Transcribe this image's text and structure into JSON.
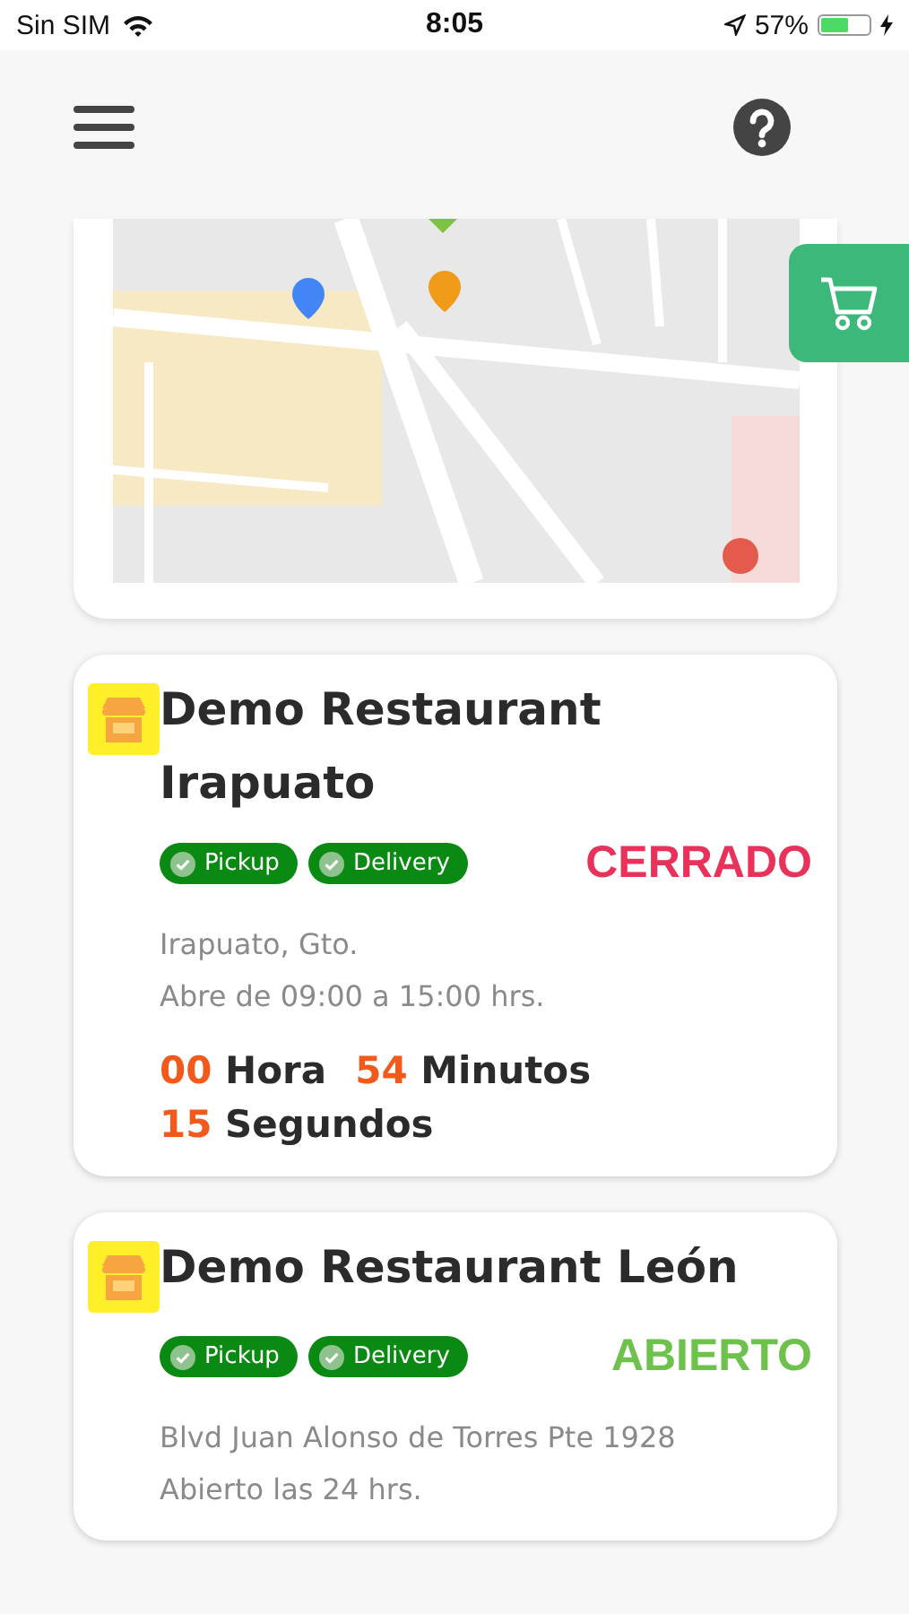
{
  "status_bar": {
    "carrier": "Sin SIM",
    "time": "8:05",
    "battery_percent": "57%",
    "battery": {
      "level": 0.57
    },
    "charging": true
  },
  "restaurants": [
    {
      "name": "Demo Restaurant Irapuato",
      "services": [
        "Pickup",
        "Delivery"
      ],
      "open": false,
      "status": "CERRADO",
      "address": "Irapuato, Gto.",
      "hours": "Abre de 09:00 a 15:00 hrs.",
      "countdown": [
        {
          "value": "00",
          "unit": "Hora"
        },
        {
          "value": "54",
          "unit": "Minutos"
        },
        {
          "value": "15",
          "unit": "Segundos"
        }
      ]
    },
    {
      "name": "Demo Restaurant León",
      "services": [
        "Pickup",
        "Delivery"
      ],
      "open": true,
      "status": "ABIERTO",
      "address": "Blvd Juan Alonso de Torres Pte 1928",
      "hours": "Abierto las 24 hrs."
    }
  ]
}
